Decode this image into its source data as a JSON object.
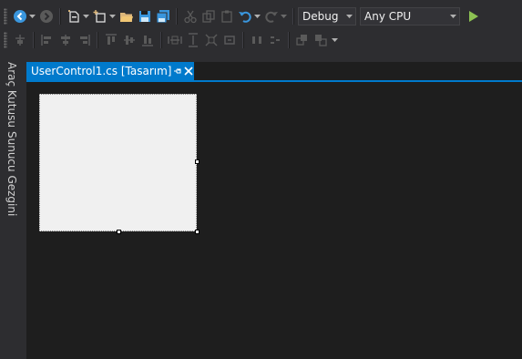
{
  "toolbar": {
    "primary": [
      {
        "name": "navigate-back-icon",
        "enabled": true
      },
      {
        "name": "navigate-forward-icon",
        "enabled": false
      },
      {
        "name": "new-project-icon",
        "enabled": true
      },
      {
        "name": "add-item-icon",
        "enabled": true
      },
      {
        "name": "open-file-icon",
        "enabled": true
      },
      {
        "name": "save-icon",
        "enabled": true
      },
      {
        "name": "save-all-icon",
        "enabled": true
      },
      {
        "name": "cut-icon",
        "enabled": false
      },
      {
        "name": "copy-icon",
        "enabled": false
      },
      {
        "name": "paste-icon",
        "enabled": false
      },
      {
        "name": "undo-icon",
        "enabled": true
      },
      {
        "name": "redo-icon",
        "enabled": false
      }
    ],
    "configuration": {
      "selected": "Debug"
    },
    "platform": {
      "selected": "Any CPU"
    },
    "start": {
      "name": "start-icon",
      "color": "#8cc152"
    }
  },
  "layout_toolbar": {
    "items": [
      "align-to-grid-icon",
      "align-lefts-icon",
      "align-centers-icon",
      "align-rights-icon",
      "align-tops-icon",
      "align-middles-icon",
      "align-bottoms-icon",
      "make-same-width-icon",
      "make-same-height-icon",
      "make-same-size-icon",
      "size-to-grid-icon",
      "horizontal-spacing-icon",
      "vertical-spacing-icon",
      "bring-to-front-icon",
      "send-to-back-icon"
    ]
  },
  "side_panel": {
    "tabs": [
      "Araç Kutusu",
      "Sunucu Gezgini"
    ]
  },
  "document_tab": {
    "title": "UserControl1.cs [Tasarım]",
    "pin_icon": "pin-icon",
    "close_icon": "close-icon"
  },
  "colors": {
    "accent": "#007acc",
    "chrome": "#2d2d30",
    "editor": "#1e1e1e",
    "design_surface": "#f0f0f0",
    "icon_blue": "#3a96dd",
    "icon_yellow": "#dcb67a",
    "icon_disabled": "#5a5a5a"
  }
}
